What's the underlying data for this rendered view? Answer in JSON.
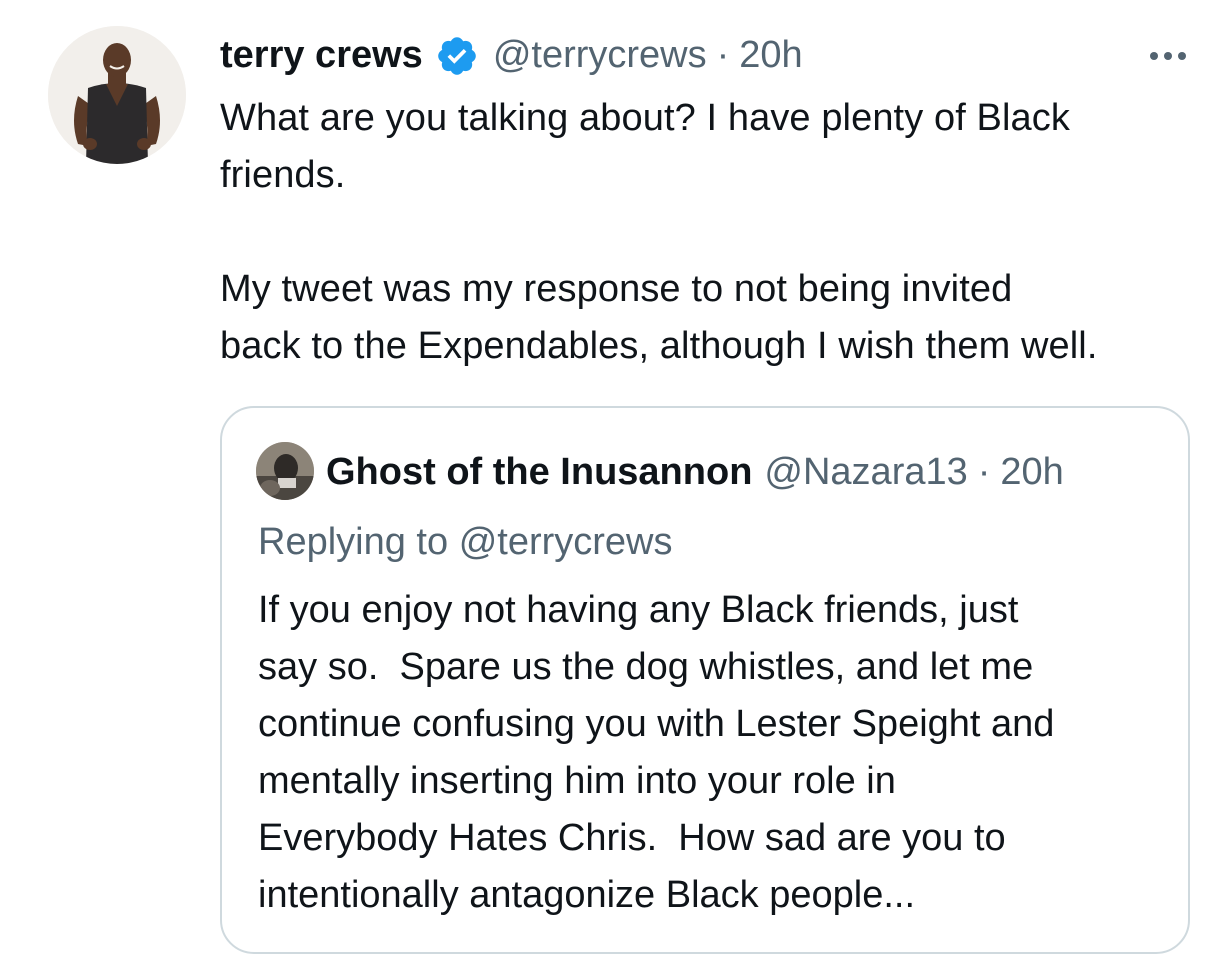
{
  "tweet": {
    "author": {
      "display_name": "terry crews",
      "verified_icon": "verified-badge-icon",
      "handle": "@terrycrews",
      "separator": "·",
      "time": "20h"
    },
    "more_icon": "more-horizontal-icon",
    "text": "What are you talking about? I have plenty of Black\nfriends.\n\nMy tweet was my response to not being invited\nback to the Expendables, although I wish them well."
  },
  "quote": {
    "author": {
      "display_name": "Ghost of the Inusannon",
      "handle": "@Nazara13",
      "separator": "·",
      "time": "20h"
    },
    "replying_prefix": "Replying to",
    "replying_handle": "@terrycrews",
    "text": "If you enjoy not having any Black friends, just\nsay so.  Spare us the dog whistles, and let me\ncontinue confusing you with Lester Speight and\nmentally inserting him into your role in\nEverybody Hates Chris.  How sad are you to\nintentionally antagonize Black people..."
  },
  "colors": {
    "text_primary": "#0f1419",
    "text_secondary": "#536471",
    "verified_blue": "#1d9bf0",
    "border": "#cfd9de"
  }
}
